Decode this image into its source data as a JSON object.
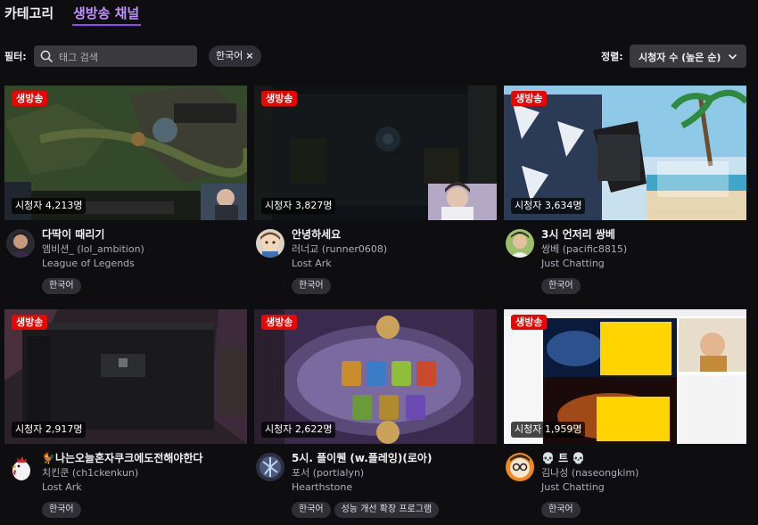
{
  "tabs": [
    {
      "label": "카테고리",
      "active": false
    },
    {
      "label": "생방송 채널",
      "active": true
    }
  ],
  "filter": {
    "label": "필터:",
    "search_placeholder": "태그 검색",
    "active_tag": "한국어",
    "remove_symbol": "×"
  },
  "sort": {
    "label": "정렬:",
    "value": "시청자 수 (높은 순)"
  },
  "colors": {
    "accent": "#9147ff",
    "active_tab_text": "#bf94ff",
    "live_badge": "#eb0400",
    "background": "#0e0e10"
  },
  "streams": [
    {
      "live": "생방송",
      "viewers": "시청자 4,213명",
      "title": "다딱이 때리기",
      "channel": "엠비션_ (lol_ambition)",
      "game": "League of Legends",
      "tags": [
        "한국어"
      ]
    },
    {
      "live": "생방송",
      "viewers": "시청자 3,827명",
      "title": "안녕하세요",
      "channel": "러너교 (runner0608)",
      "game": "Lost Ark",
      "tags": [
        "한국어"
      ]
    },
    {
      "live": "생방송",
      "viewers": "시청자 3,634명",
      "title": "3시 언저리 쌍베",
      "channel": "쌍베 (pacific8815)",
      "game": "Just Chatting",
      "tags": [
        "한국어"
      ]
    },
    {
      "live": "생방송",
      "viewers": "시청자 2,917명",
      "title": "🐓나는오늘혼자쿠크에도전해야한다",
      "channel": "치킨쿤 (ch1ckenkun)",
      "game": "Lost Ark",
      "tags": [
        "한국어"
      ]
    },
    {
      "live": "생방송",
      "viewers": "시청자 2,622명",
      "title": "5시. 플이퀜 (w.플레잉)(로아)",
      "channel": "포서 (portialyn)",
      "game": "Hearthstone",
      "tags": [
        "한국어",
        "성능 개선 확장 프로그램"
      ]
    },
    {
      "live": "생방송",
      "viewers": "시청자 1,959명",
      "title": "💀 트 💀",
      "channel": "김나성 (naseongkim)",
      "game": "Just Chatting",
      "tags": [
        "한국어"
      ]
    }
  ]
}
